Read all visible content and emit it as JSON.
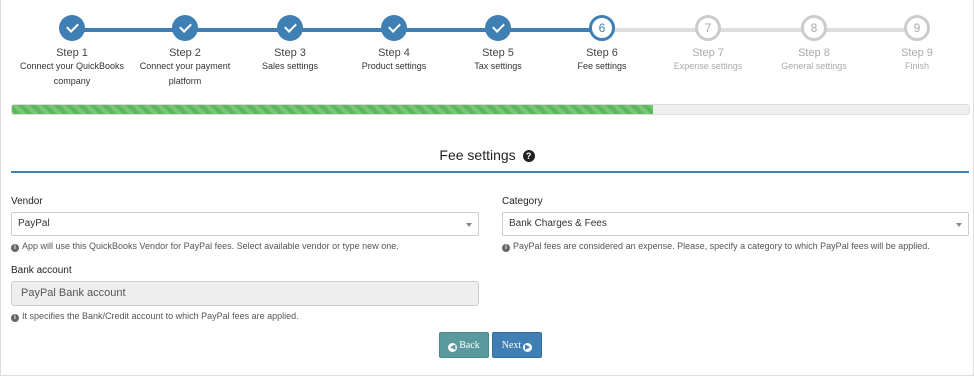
{
  "steps": [
    {
      "title": "Step 1",
      "desc_line1": "Connect your QuickBooks",
      "desc_line2": "company",
      "status": "done"
    },
    {
      "title": "Step 2",
      "desc_line1": "Connect your payment",
      "desc_line2": "platform",
      "status": "done"
    },
    {
      "title": "Step 3",
      "desc_line1": "Sales settings",
      "desc_line2": "",
      "status": "done"
    },
    {
      "title": "Step 4",
      "desc_line1": "Product settings",
      "desc_line2": "",
      "status": "done"
    },
    {
      "title": "Step 5",
      "desc_line1": "Tax settings",
      "desc_line2": "",
      "status": "done"
    },
    {
      "title": "Step 6",
      "number": "6",
      "desc_line1": "Fee settings",
      "desc_line2": "",
      "status": "current"
    },
    {
      "title": "Step 7",
      "number": "7",
      "desc_line1": "Expense settings",
      "desc_line2": "",
      "status": "todo"
    },
    {
      "title": "Step 8",
      "number": "8",
      "desc_line1": "General settings",
      "desc_line2": "",
      "status": "todo"
    },
    {
      "title": "Step 9",
      "number": "9",
      "desc_line1": "Finish",
      "desc_line2": "",
      "status": "todo"
    }
  ],
  "progress": {
    "percent": 67
  },
  "section": {
    "title": "Fee settings",
    "help_icon": "question-circle-icon"
  },
  "vendor": {
    "label": "Vendor",
    "value": "PayPal",
    "hint": "App will use this QuickBooks Vendor for PayPal fees. Select available vendor or type new one."
  },
  "category": {
    "label": "Category",
    "value": "Bank Charges & Fees",
    "hint": "PayPal fees are considered an expense. Please, specify a category to which PayPal fees will be applied."
  },
  "bank_account": {
    "label": "Bank account",
    "value": "PayPal Bank account",
    "hint": "It specifies the Bank/Credit account to which PayPal fees are applied."
  },
  "buttons": {
    "back_label": "Back",
    "next_label": "Next"
  },
  "colors": {
    "primary": "#3f7fb3",
    "progress": "#5cb85c",
    "back_button": "#5a9a9e"
  }
}
